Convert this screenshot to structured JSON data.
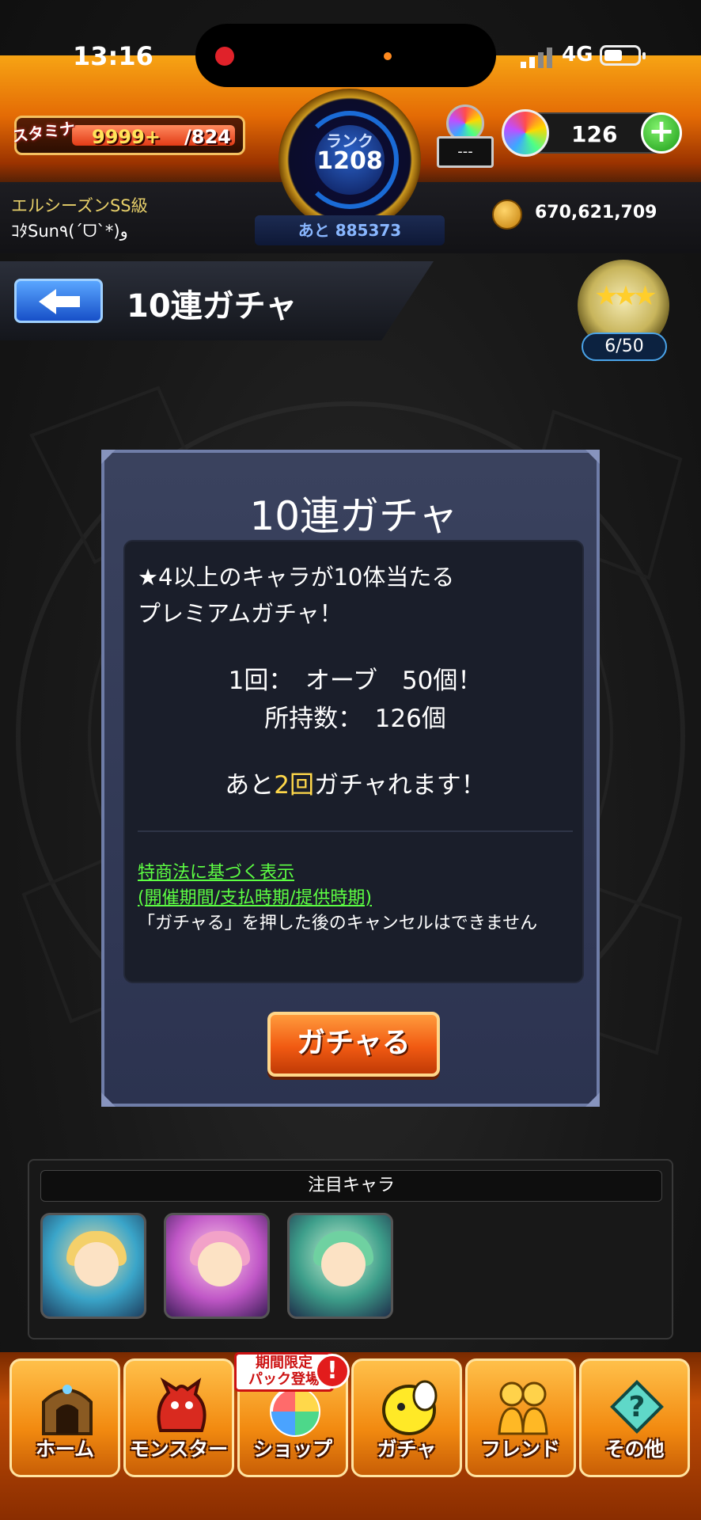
{
  "status_bar": {
    "time": "13:16",
    "network": "4G"
  },
  "header": {
    "stamina_label": "スタミナ",
    "stamina_value": "9999+",
    "stamina_max": "/824",
    "rank_label": "ランク",
    "rank_value": "1208",
    "rank_next": "あと 885373",
    "item_box_text": "---",
    "orb_count": "126",
    "plus_symbol": "+",
    "player_title": "エルシーズンSS級",
    "player_name": "ｺﾀSun٩(ˊᗜˋ*)و",
    "coins": "670,621,709"
  },
  "title_bar": {
    "title": "10連ガチャ",
    "medal_count": "6/50",
    "medal_stars": "★★★"
  },
  "dialog": {
    "title": "10連ガチャ",
    "desc_line1": "★4以上のキャラが10体当たる",
    "desc_line2": "プレミアムガチャ！",
    "price_line": "1回：　オーブ　50個！",
    "owned_line": "所持数：　126個",
    "remain_prefix": "あと",
    "remain_count": "2回",
    "remain_suffix": "ガチャれます！",
    "legal_link_1": "特商法に基づく表示",
    "legal_link_2": "(開催期間/支払時期/提供時期)",
    "legal_note": "「ガチャる」を押した後のキャンセルはできません",
    "gacha_button": "ガチャる"
  },
  "featured": {
    "header": "注目キャラ"
  },
  "tabs": [
    {
      "label": "ホーム",
      "icon": "gate-icon"
    },
    {
      "label": "モンスター",
      "icon": "dragon-icon"
    },
    {
      "label": "ショップ",
      "icon": "orb-icon"
    },
    {
      "label": "ガチャ",
      "icon": "chick-icon"
    },
    {
      "label": "フレンド",
      "icon": "friends-icon"
    },
    {
      "label": "その他",
      "icon": "other-icon"
    }
  ],
  "shop_badge": {
    "line1": "期間限定",
    "line2": "パック登場",
    "alert": "!"
  }
}
